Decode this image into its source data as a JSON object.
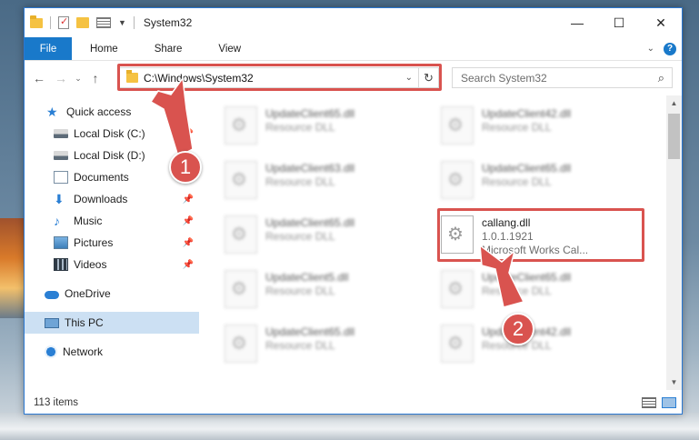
{
  "window": {
    "title": "System32",
    "controls": {
      "minimize": "—",
      "maximize": "☐",
      "close": "✕"
    }
  },
  "ribbon": {
    "file_tab": "File",
    "tabs": [
      "Home",
      "Share",
      "View"
    ]
  },
  "navigation": {
    "back": "←",
    "forward": "→",
    "recent": "⌄",
    "up": "↑",
    "address": "C:\\Windows\\System32",
    "search_placeholder": "Search System32"
  },
  "sidebar": {
    "items": [
      {
        "label": "Quick access",
        "icon": "star-icon",
        "pinned": false
      },
      {
        "label": "Local Disk (C:)",
        "icon": "drive-icon",
        "pinned": true
      },
      {
        "label": "Local Disk (D:)",
        "icon": "drive-icon",
        "pinned": false
      },
      {
        "label": "Documents",
        "icon": "documents-icon",
        "pinned": true
      },
      {
        "label": "Downloads",
        "icon": "download-icon",
        "pinned": true
      },
      {
        "label": "Music",
        "icon": "music-icon",
        "pinned": true
      },
      {
        "label": "Pictures",
        "icon": "pictures-icon",
        "pinned": true
      },
      {
        "label": "Videos",
        "icon": "videos-icon",
        "pinned": true
      },
      {
        "label": "OneDrive",
        "icon": "onedrive-icon",
        "pinned": false
      },
      {
        "label": "This PC",
        "icon": "computer-icon",
        "pinned": false,
        "selected": true
      },
      {
        "label": "Network",
        "icon": "network-icon",
        "pinned": false
      }
    ]
  },
  "files": [
    {
      "name": "UpdateClient65.dll",
      "type": "Resource DLL"
    },
    {
      "name": "UpdateClient42.dll",
      "type": "Resource DLL"
    },
    {
      "name": "UpdateClient63.dll",
      "type": "Resource DLL"
    },
    {
      "name": "UpdateClient65.dll",
      "type": "Resource DLL"
    },
    {
      "name": "UpdateClient65.dll",
      "type": "Resource DLL"
    },
    {
      "name": "callang.dll",
      "version": "1.0.1.1921",
      "description": "Microsoft Works Cal..."
    },
    {
      "name": "UpdateClient5.dll",
      "type": "Resource DLL"
    },
    {
      "name": "UpdateClient65.dll",
      "type": "Resource DLL"
    },
    {
      "name": "UpdateClient65.dll",
      "type": "Resource DLL"
    },
    {
      "name": "UpdateClient42.dll",
      "type": "Resource DLL"
    }
  ],
  "status": {
    "item_count": "113 items"
  },
  "annotations": {
    "callout1": "1",
    "callout2": "2",
    "highlight_color": "#d9534f"
  },
  "colors": {
    "accent": "#1979ca",
    "selection": "#cce0f3",
    "border": "#2b78d2"
  }
}
